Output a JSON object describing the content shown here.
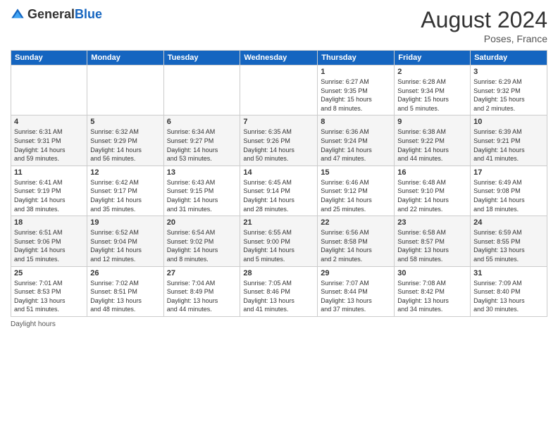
{
  "header": {
    "logo_general": "General",
    "logo_blue": "Blue",
    "month_year": "August 2024",
    "location": "Poses, France"
  },
  "days_of_week": [
    "Sunday",
    "Monday",
    "Tuesday",
    "Wednesday",
    "Thursday",
    "Friday",
    "Saturday"
  ],
  "weeks": [
    [
      {
        "day": "",
        "info": ""
      },
      {
        "day": "",
        "info": ""
      },
      {
        "day": "",
        "info": ""
      },
      {
        "day": "",
        "info": ""
      },
      {
        "day": "1",
        "info": "Sunrise: 6:27 AM\nSunset: 9:35 PM\nDaylight: 15 hours\nand 8 minutes."
      },
      {
        "day": "2",
        "info": "Sunrise: 6:28 AM\nSunset: 9:34 PM\nDaylight: 15 hours\nand 5 minutes."
      },
      {
        "day": "3",
        "info": "Sunrise: 6:29 AM\nSunset: 9:32 PM\nDaylight: 15 hours\nand 2 minutes."
      }
    ],
    [
      {
        "day": "4",
        "info": "Sunrise: 6:31 AM\nSunset: 9:31 PM\nDaylight: 14 hours\nand 59 minutes."
      },
      {
        "day": "5",
        "info": "Sunrise: 6:32 AM\nSunset: 9:29 PM\nDaylight: 14 hours\nand 56 minutes."
      },
      {
        "day": "6",
        "info": "Sunrise: 6:34 AM\nSunset: 9:27 PM\nDaylight: 14 hours\nand 53 minutes."
      },
      {
        "day": "7",
        "info": "Sunrise: 6:35 AM\nSunset: 9:26 PM\nDaylight: 14 hours\nand 50 minutes."
      },
      {
        "day": "8",
        "info": "Sunrise: 6:36 AM\nSunset: 9:24 PM\nDaylight: 14 hours\nand 47 minutes."
      },
      {
        "day": "9",
        "info": "Sunrise: 6:38 AM\nSunset: 9:22 PM\nDaylight: 14 hours\nand 44 minutes."
      },
      {
        "day": "10",
        "info": "Sunrise: 6:39 AM\nSunset: 9:21 PM\nDaylight: 14 hours\nand 41 minutes."
      }
    ],
    [
      {
        "day": "11",
        "info": "Sunrise: 6:41 AM\nSunset: 9:19 PM\nDaylight: 14 hours\nand 38 minutes."
      },
      {
        "day": "12",
        "info": "Sunrise: 6:42 AM\nSunset: 9:17 PM\nDaylight: 14 hours\nand 35 minutes."
      },
      {
        "day": "13",
        "info": "Sunrise: 6:43 AM\nSunset: 9:15 PM\nDaylight: 14 hours\nand 31 minutes."
      },
      {
        "day": "14",
        "info": "Sunrise: 6:45 AM\nSunset: 9:14 PM\nDaylight: 14 hours\nand 28 minutes."
      },
      {
        "day": "15",
        "info": "Sunrise: 6:46 AM\nSunset: 9:12 PM\nDaylight: 14 hours\nand 25 minutes."
      },
      {
        "day": "16",
        "info": "Sunrise: 6:48 AM\nSunset: 9:10 PM\nDaylight: 14 hours\nand 22 minutes."
      },
      {
        "day": "17",
        "info": "Sunrise: 6:49 AM\nSunset: 9:08 PM\nDaylight: 14 hours\nand 18 minutes."
      }
    ],
    [
      {
        "day": "18",
        "info": "Sunrise: 6:51 AM\nSunset: 9:06 PM\nDaylight: 14 hours\nand 15 minutes."
      },
      {
        "day": "19",
        "info": "Sunrise: 6:52 AM\nSunset: 9:04 PM\nDaylight: 14 hours\nand 12 minutes."
      },
      {
        "day": "20",
        "info": "Sunrise: 6:54 AM\nSunset: 9:02 PM\nDaylight: 14 hours\nand 8 minutes."
      },
      {
        "day": "21",
        "info": "Sunrise: 6:55 AM\nSunset: 9:00 PM\nDaylight: 14 hours\nand 5 minutes."
      },
      {
        "day": "22",
        "info": "Sunrise: 6:56 AM\nSunset: 8:58 PM\nDaylight: 14 hours\nand 2 minutes."
      },
      {
        "day": "23",
        "info": "Sunrise: 6:58 AM\nSunset: 8:57 PM\nDaylight: 13 hours\nand 58 minutes."
      },
      {
        "day": "24",
        "info": "Sunrise: 6:59 AM\nSunset: 8:55 PM\nDaylight: 13 hours\nand 55 minutes."
      }
    ],
    [
      {
        "day": "25",
        "info": "Sunrise: 7:01 AM\nSunset: 8:53 PM\nDaylight: 13 hours\nand 51 minutes."
      },
      {
        "day": "26",
        "info": "Sunrise: 7:02 AM\nSunset: 8:51 PM\nDaylight: 13 hours\nand 48 minutes."
      },
      {
        "day": "27",
        "info": "Sunrise: 7:04 AM\nSunset: 8:49 PM\nDaylight: 13 hours\nand 44 minutes."
      },
      {
        "day": "28",
        "info": "Sunrise: 7:05 AM\nSunset: 8:46 PM\nDaylight: 13 hours\nand 41 minutes."
      },
      {
        "day": "29",
        "info": "Sunrise: 7:07 AM\nSunset: 8:44 PM\nDaylight: 13 hours\nand 37 minutes."
      },
      {
        "day": "30",
        "info": "Sunrise: 7:08 AM\nSunset: 8:42 PM\nDaylight: 13 hours\nand 34 minutes."
      },
      {
        "day": "31",
        "info": "Sunrise: 7:09 AM\nSunset: 8:40 PM\nDaylight: 13 hours\nand 30 minutes."
      }
    ]
  ],
  "footer": {
    "daylight_label": "Daylight hours"
  }
}
